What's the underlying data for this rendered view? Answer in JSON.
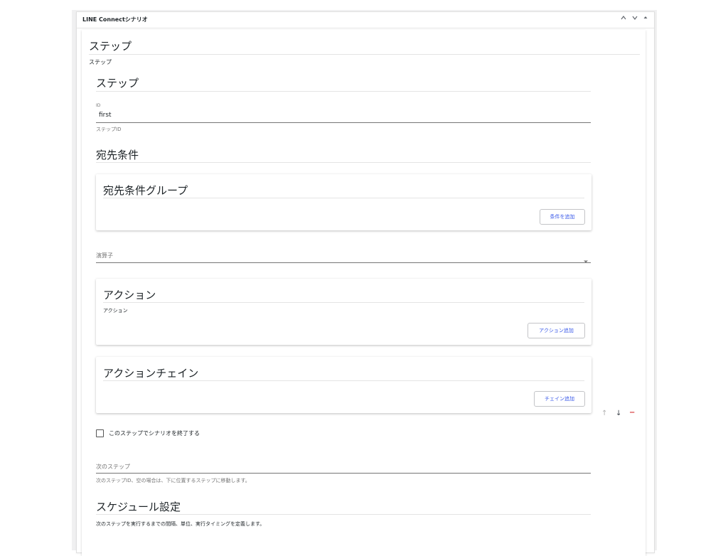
{
  "panel": {
    "title": "LINE Connectシナリオ",
    "controls": [
      "^",
      "v",
      "▴"
    ]
  },
  "step": {
    "heading": "ステップ",
    "subtitle": "ステップ",
    "inner_heading": "ステップ",
    "id_label": "ID",
    "id_value": "first",
    "id_help": "ステップID"
  },
  "destination": {
    "heading": "宛先条件",
    "group_heading": "宛先条件グループ",
    "add_condition_label": "条件を追加",
    "operator_placeholder": "演算子"
  },
  "actions": {
    "heading": "アクション",
    "subtitle": "アクション",
    "add_label": "アクション追加"
  },
  "chain": {
    "heading": "アクションチェイン",
    "add_label": "チェイン追加"
  },
  "row_controls": {
    "up": "↑",
    "down": "↓",
    "remove": "−"
  },
  "end_scenario": {
    "label": "このステップでシナリオを終了する",
    "checked": false
  },
  "next_step": {
    "label": "次のステップ",
    "help": "次のステップID、空の場合は、下に位置するステップに移動します。"
  },
  "schedule": {
    "heading": "スケジュール設定",
    "help": "次のステップを実行するまでの間隔、単位、実行タイミングを定義します。"
  },
  "colors": {
    "accent": "#3858e9",
    "danger": "#d63638"
  }
}
